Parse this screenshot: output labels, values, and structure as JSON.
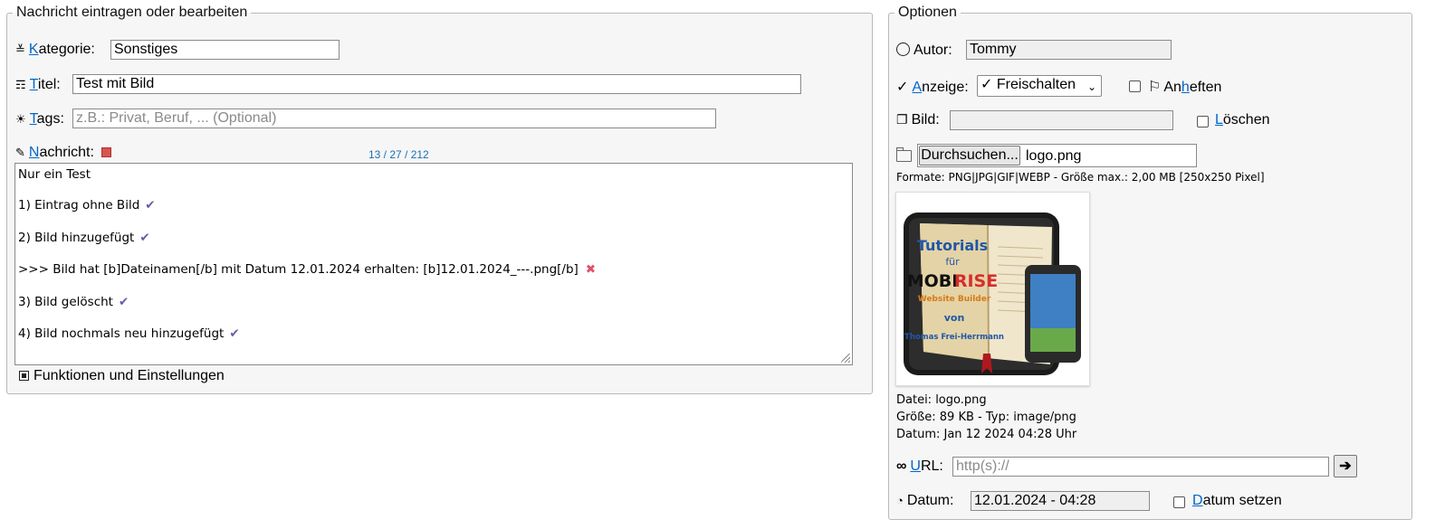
{
  "left": {
    "legend": "Nachricht eintragen oder bearbeiten",
    "kategorie": {
      "accesskey": "K",
      "label_rest": "ategorie:",
      "value": "Sonstiges"
    },
    "titel": {
      "accesskey": "T",
      "label_rest": "itel:",
      "value": "Test mit Bild"
    },
    "tags": {
      "accesskey": "T",
      "label_rest": "ags:",
      "placeholder": "z.B.: Privat, Beruf, ... (Optional)"
    },
    "nachricht": {
      "accesskey": "N",
      "label_rest": "achricht:",
      "counter": "13 / 27 / 212"
    },
    "message_lines": [
      "Nur ein Test",
      "1) Eintrag ohne Bild",
      "2) Bild hinzugefügt",
      ">>> Bild hat [b]Dateinamen[/b] mit Datum 12.01.2024 erhalten: [b]12.01.2024_---.png[/b]",
      "3) Bild gelöscht",
      "4) Bild nochmals neu hinzugefügt"
    ],
    "marks": [
      "",
      "✔",
      "✔",
      "✖",
      "✔",
      "✔"
    ],
    "functions_label": "Funktionen und Einstellungen"
  },
  "right": {
    "legend": "Optionen",
    "autor": {
      "label": "Autor:",
      "value": "Tommy"
    },
    "anzeige": {
      "accesskey": "A",
      "label_rest": "nzeige:",
      "value": "✓ Freischalten"
    },
    "anheften": {
      "pre": "An",
      "accesskey": "h",
      "post": "eften"
    },
    "bild": {
      "label": "Bild:"
    },
    "loeschen": {
      "accesskey": "L",
      "label_rest": "öschen"
    },
    "upload": {
      "button": "Durchsuchen...",
      "filename": "logo.png"
    },
    "formats": "Formate: PNG|JPG|GIF|WEBP - Größe max.: 2,00 MB [250x250 Pixel]",
    "preview": {
      "title_line1": "Tutorials",
      "title_line2": "für",
      "brand_a": "MOBI",
      "brand_b": "RISE",
      "subtitle": "Website Builder",
      "von": "von",
      "author": "Thomas Frei-Herrmann"
    },
    "file_info": [
      "Datei: logo.png",
      "Größe: 89 KB - Typ: image/png",
      "Datum: Jan 12 2024 04:28 Uhr"
    ],
    "url": {
      "accesskey": "U",
      "label_rest": "RL:",
      "placeholder": "http(s)://",
      "button": "➔"
    },
    "datum": {
      "label": "Datum:",
      "value": "12.01.2024 - 04:28",
      "set_accesskey": "D",
      "set_rest": "atum setzen"
    }
  }
}
